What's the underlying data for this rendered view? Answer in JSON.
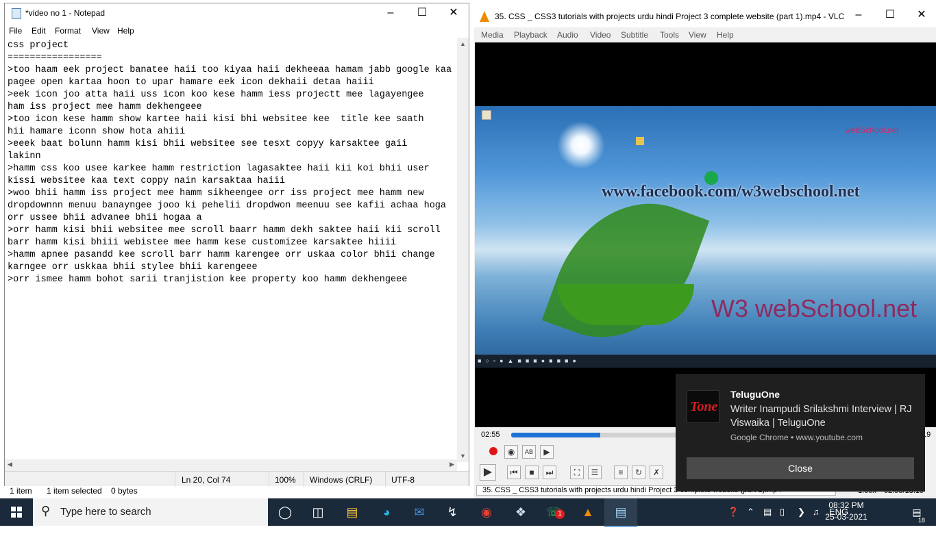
{
  "explorer_status": {
    "item_count": "1 item",
    "selected": "1 item selected",
    "size": "0 bytes"
  },
  "notepad": {
    "title": "*video no 1 - Notepad",
    "menu": [
      "File",
      "Edit",
      "Format",
      "View",
      "Help"
    ],
    "content": "css project\n=================\n>too haam eek project banatee haii too kiyaa haii dekheeaa hamam jabb google kaa\npagee open kartaa hoon to upar hamare eek icon dekhaii detaa haiii\n>eek icon joo atta haii uss icon koo kese hamm iess projectt mee lagayengee\nham iss project mee hamm dekhengeee\n>too icon kese hamm show kartee haii kisi bhi websitee kee  title kee saath\nhii hamare iconn show hota ahiii\n>eeek baat bolunn hamm kisi bhii websitee see tesxt copyy karsaktee gaii\nlakinn\n>hamm css koo usee karkee hamm restriction lagasaktee haii kii koi bhii user\nkissi websitee kaa text coppy nain karsaktaa haiii\n>woo bhii hamm iss project mee hamm sikheengee orr iss project mee hamm new\ndropdownnn menuu banayngee jooo ki pehelii dropdwon meenuu see kafii achaa hoga\norr ussee bhii advanee bhii hogaa a\n>orr hamm kisi bhii websitee mee scroll baarr hamm dekh saktee haii kii scroll\nbarr hamm kisi bhiii webistee mee hamm kese customizee karsaktee hiiii\n>hamm apnee pasandd kee scroll barr hamm karengee orr uskaa color bhii change\nkarngee orr uskkaa bhii stylee bhii karengeee\n>orr ismee hamm bohot sarii tranjistion kee property koo hamm dekhengeee",
    "status": {
      "position": "Ln 20, Col 74",
      "zoom": "100%",
      "line_ending": "Windows (CRLF)",
      "encoding": "UTF-8"
    }
  },
  "vlc": {
    "title": "35. CSS _ CSS3 tutorials with projects urdu hindi Project 3 complete website (part 1).mp4 - VLC ...",
    "menu": [
      "Media",
      "Playback",
      "Audio",
      "Video",
      "Subtitle",
      "Tools",
      "View",
      "Help"
    ],
    "video_overlay": {
      "url_text": "www.facebook.com/w3webschool.net",
      "logo_text": "W3 webSchool.net",
      "small_logo": "webSchool.net"
    },
    "time_elapsed": "02:55",
    "time_right_partial": "19",
    "seek_fraction": 0.22,
    "status_title": "35. CSS _ CSS3 tutorials with projects urdu hindi Project 3 complete website (part 1).mp4",
    "status_speed": "1.00x",
    "status_time": "02:55/13:19"
  },
  "toast": {
    "app": "TeluguOne",
    "body": "Writer Inampudi Srilakshmi Interview | RJ Viswaika | TeluguOne",
    "source": "Google Chrome • www.youtube.com",
    "close_label": "Close",
    "logo_text": "Tone"
  },
  "taskbar": {
    "search_placeholder": "Type here to search",
    "language": "ENG",
    "time": "08:32 PM",
    "date": "25-03-2021",
    "notification_count": "18",
    "whatsapp_badge": "1"
  },
  "colors": {
    "taskbar_bg": "#1b2a3a",
    "vlc_orange": "#f08b00",
    "seek_blue": "#1d72d5",
    "toast_bg": "#1f1f1f"
  }
}
